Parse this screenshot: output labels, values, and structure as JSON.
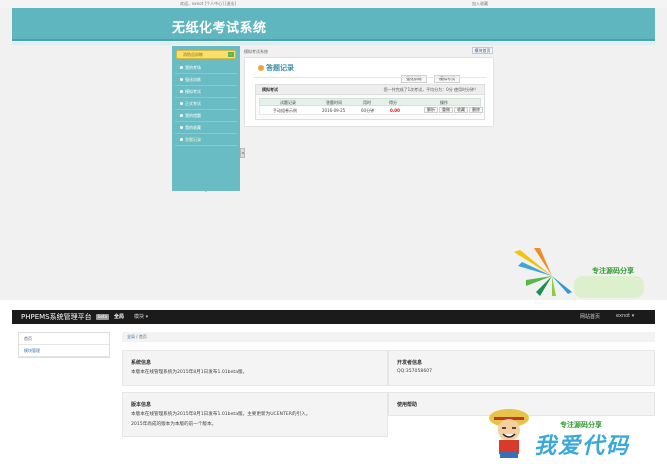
{
  "exam": {
    "topbar": {
      "left": "欢迎，exnot [个人中心]    [退出]",
      "right": "加入收藏"
    },
    "title": "无纸化考试系统",
    "sidebar": {
      "header": "消防员训练",
      "toggle": "-",
      "items": [
        {
          "label": "我的考场",
          "active": false
        },
        {
          "label": "强化训练",
          "active": false
        },
        {
          "label": "模拟考试",
          "active": false
        },
        {
          "label": "正式考试",
          "active": false
        },
        {
          "label": "我的错题",
          "active": false
        },
        {
          "label": "我的收藏",
          "active": false
        },
        {
          "label": "答题记录",
          "active": true
        }
      ]
    },
    "collapse_handle": "◂",
    "breadcrumb": "模拟考试系统",
    "home_button": "模块首页",
    "panel": {
      "title": "答题记录",
      "tabs": [
        {
          "label": "强化训练",
          "active": false
        },
        {
          "label": "模拟考试",
          "active": false
        },
        {
          "label": "正式考试",
          "active": true
        }
      ],
      "mode": "模拟考试",
      "stats": "您一共完成了1次考试，平均分为：0分 使用时分钟？",
      "columns": [
        "试题记录",
        "答题时间",
        "用时",
        "得分",
        "操作"
      ],
      "rows": [
        {
          "name": "手动组卷示例",
          "time": "2016-09-25",
          "duration": "60分钟",
          "score": "0.00",
          "actions": [
            "解析",
            "重做",
            "收藏",
            "删除"
          ]
        }
      ]
    }
  },
  "watermark": {
    "top_text": "专注源码分享",
    "bottom_text": "专注源码分享",
    "bottom_big": "我爱代码"
  },
  "admin": {
    "brand": "PHPEMS系统管理平台",
    "beta": "beta",
    "nav": [
      {
        "label": "全局",
        "active": true
      },
      {
        "label": "模块",
        "active": false
      }
    ],
    "nav_right": [
      "网站首页",
      "exnot"
    ],
    "side": [
      {
        "label": "首页",
        "active": false
      },
      {
        "label": "模块管理",
        "active": true
      }
    ],
    "breadcrumb": {
      "link": "全局",
      "current": "首页"
    },
    "cards": {
      "system": {
        "title": "系统信息",
        "lines": [
          "本版本在线管理系统为2015年8月1日发布1.01beta版。"
        ]
      },
      "dev": {
        "title": "开发者信息",
        "lines": [
          "QQ:357058607"
        ]
      },
      "version": {
        "title": "版本信息",
        "lines": [
          "本版本在线管理系统为2015年8月1日发布1.01beta版。主要更新为UCENTER的引入。",
          "2015年尚成的版本为本版的前一个版本。"
        ]
      },
      "help": {
        "title": "使用帮助",
        "lines": []
      }
    }
  }
}
